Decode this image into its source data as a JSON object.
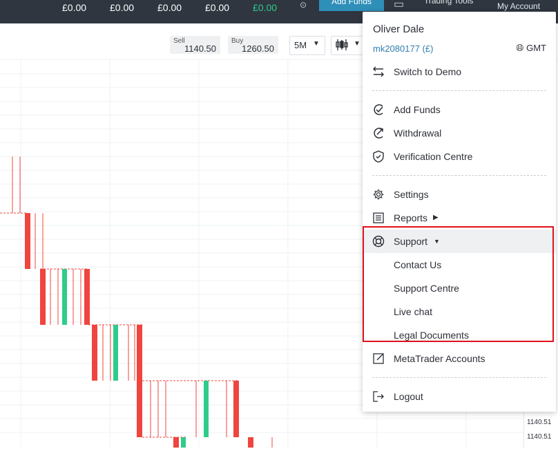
{
  "topbar": {
    "balances": [
      "£0.00",
      "£0.00",
      "£0.00",
      "£0.00",
      "£0.00"
    ],
    "add_funds": "Add Funds",
    "trading_tools": "Trading Tools",
    "my_account": "My Account"
  },
  "toolbar": {
    "sell_label": "Sell",
    "sell_value": "1140.50",
    "buy_label": "Buy",
    "buy_value": "1260.50",
    "timeframe": "5M"
  },
  "axis": {
    "labels": [
      "1140.51",
      "1140.51"
    ]
  },
  "menu": {
    "user_name": "Oliver Dale",
    "account_id": "mk2080177 (£)",
    "timezone": "GMT",
    "switch_demo": "Switch to Demo",
    "add_funds": "Add Funds",
    "withdrawal": "Withdrawal",
    "verification": "Verification Centre",
    "settings": "Settings",
    "reports": "Reports",
    "support": "Support",
    "contact_us": "Contact Us",
    "support_centre": "Support Centre",
    "live_chat": "Live chat",
    "legal_documents": "Legal Documents",
    "metatrader": "MetaTrader Accounts",
    "logout": "Logout"
  },
  "colors": {
    "topbar": "#2f3640",
    "accent": "#2e8fb8",
    "bull": "#2ecc8a",
    "bear": "#f0443f",
    "highlight": "#e0101a"
  }
}
